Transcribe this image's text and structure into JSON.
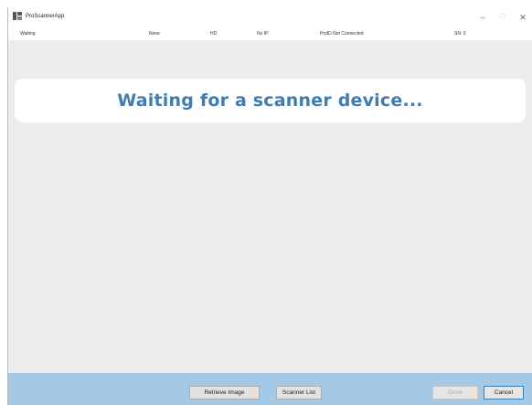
{
  "window": {
    "title": "ProScannerApp",
    "minimize_glyph": "–",
    "maximize_glyph": "☐",
    "close_glyph": "✕"
  },
  "status": {
    "state": "Waiting",
    "device": "None",
    "mode": "HD",
    "ip": "No IP",
    "connection": "ProID Not Connected",
    "serial": "SN: 0"
  },
  "banner": {
    "message": "Waiting for a scanner device..."
  },
  "footer": {
    "retrieve_image_label": "Retrieve Image",
    "scanner_list_label": "Scanner List",
    "done_label": "Done",
    "cancel_label": "Cancel"
  },
  "colors": {
    "banner_text": "#3d7cb5",
    "footer_bg": "#a4c9e6",
    "content_bg": "#ececec"
  }
}
